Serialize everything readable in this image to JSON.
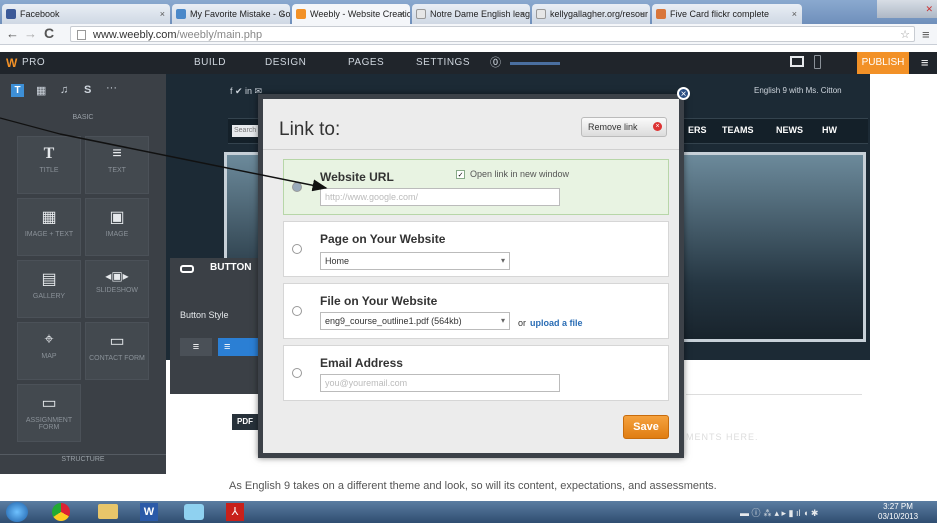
{
  "browser": {
    "tabs": [
      {
        "title": "Facebook",
        "color": "#3b5998"
      },
      {
        "title": "My Favorite Mistake - Goo",
        "color": "#4a88c9"
      },
      {
        "title": "Weebly - Website Creation",
        "color": "#f29127",
        "active": true
      },
      {
        "title": "Notre Dame English leagu",
        "color": "#cccccc"
      },
      {
        "title": "kellygallagher.org/resour",
        "color": "#cccccc"
      },
      {
        "title": "Five Card flickr complete",
        "color": "#d9763a"
      }
    ],
    "url_host": "www.weebly.com",
    "url_path": "/weebly/main.php"
  },
  "weebly": {
    "logo": "PRO",
    "nav": [
      "BUILD",
      "DESIGN",
      "PAGES",
      "SETTINGS"
    ],
    "publish": "PUBLISH",
    "brand_color": "#f29127"
  },
  "sidebar": {
    "basic_label": "BASIC",
    "structure_label": "STRUCTURE",
    "tiles": [
      {
        "label": "TITLE",
        "icon": "T"
      },
      {
        "label": "TEXT",
        "icon": "≡"
      },
      {
        "label": "IMAGE + TEXT",
        "icon": "▦"
      },
      {
        "label": "IMAGE",
        "icon": "▣"
      },
      {
        "label": "GALLERY",
        "icon": "▤"
      },
      {
        "label": "SLIDESHOW",
        "icon": "◂▣▸"
      },
      {
        "label": "MAP",
        "icon": "⌖"
      },
      {
        "label": "CONTACT FORM",
        "icon": "▭"
      },
      {
        "label": "ASSIGNMENT FORM",
        "icon": "▭"
      }
    ]
  },
  "site": {
    "header_right": "English 9 with Ms. Citton",
    "nav": [
      "ERS",
      "TEAMS",
      "NEWS",
      "HW"
    ],
    "search_placeholder": "Search",
    "body_text": "As English 9 takes on a different theme and look, so will its content, expectations, and assessments.",
    "ghost_text": "MENTS HERE.",
    "pdf_label": "PDF"
  },
  "button_panel": {
    "title": "BUTTON",
    "style_label": "Button Style"
  },
  "modal": {
    "title": "Link to:",
    "remove_label": "Remove link",
    "options": [
      {
        "label": "Website URL",
        "checkbox_label": "Open link in new window",
        "placeholder": "http://www.google.com/",
        "selected": true
      },
      {
        "label": "Page on Your Website",
        "select_value": "Home"
      },
      {
        "label": "File on Your Website",
        "select_value": "eng9_course_outline1.pdf (564kb)",
        "or_text": "or",
        "upload_link": "upload a file"
      },
      {
        "label": "Email Address",
        "placeholder": "you@youremail.com"
      }
    ],
    "save_label": "Save"
  },
  "taskbar": {
    "time": "3:27 PM",
    "date": "03/10/2013"
  }
}
